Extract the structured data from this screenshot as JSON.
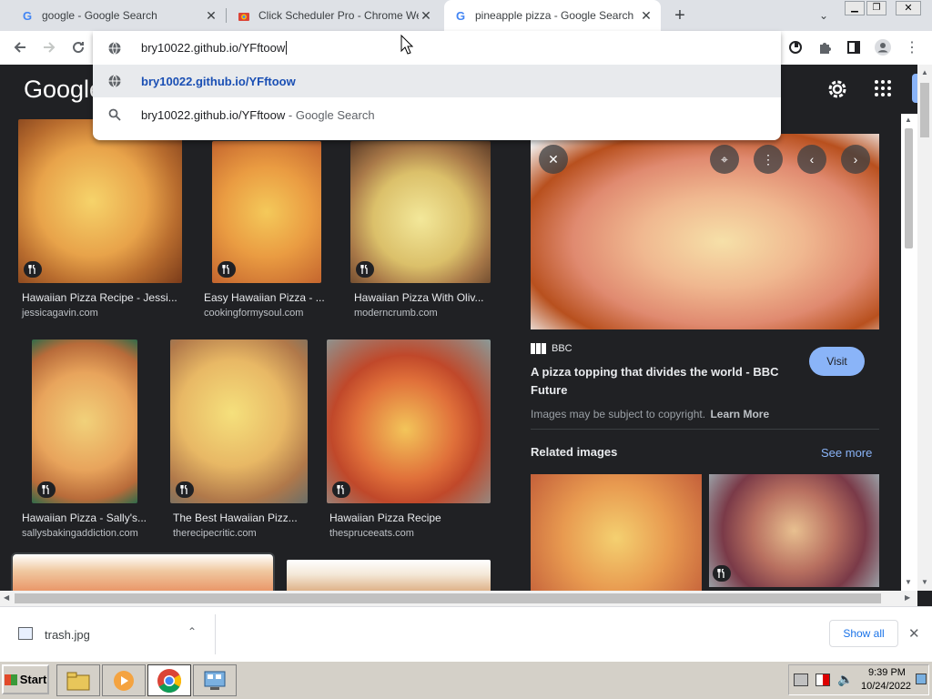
{
  "tabs": [
    {
      "title": "google - Google Search",
      "favicon": "G"
    },
    {
      "title": "Click Scheduler Pro - Chrome We",
      "favicon": "chrome-store"
    },
    {
      "title": "pineapple pizza - Google Search",
      "favicon": "G"
    }
  ],
  "omnibox": {
    "value": "bry10022.github.io/YFftoow",
    "suggestions": [
      {
        "text": "bry10022.github.io/YFftoow",
        "suffix": ""
      },
      {
        "text": "bry10022.github.io/YFftoow",
        "suffix": " - Google Search"
      }
    ]
  },
  "google": {
    "logo": "Google"
  },
  "results": [
    {
      "caption": "Hawaiian Pizza Recipe - Jessi...",
      "source": "jessicagavin.com"
    },
    {
      "caption": "Easy Hawaiian Pizza - ...",
      "source": "cookingformysoul.com"
    },
    {
      "caption": "Hawaiian Pizza With Oliv...",
      "source": "moderncrumb.com"
    },
    {
      "caption": "Hawaiian Pizza - Sally's...",
      "source": "sallysbakingaddiction.com"
    },
    {
      "caption": "The Best Hawaiian Pizz...",
      "source": "therecipecritic.com"
    },
    {
      "caption": "Hawaiian Pizza Recipe",
      "source": "thespruceeats.com"
    }
  ],
  "panel": {
    "source": "BBC",
    "title": "A pizza topping that divides the world - BBC Future",
    "visit": "Visit",
    "copyright": "Images may be subject to copyright.",
    "learn_more": "Learn More",
    "related": "Related images",
    "see_more": "See more"
  },
  "download": {
    "filename": "trash.jpg",
    "show_all": "Show all"
  },
  "taskbar": {
    "start": "Start",
    "time": "9:39 PM",
    "date": "10/24/2022"
  },
  "colors": {
    "accent_blue": "#8ab4f8",
    "visit_btn": "#8ab4f8",
    "link_blue": "#1a73e8"
  }
}
